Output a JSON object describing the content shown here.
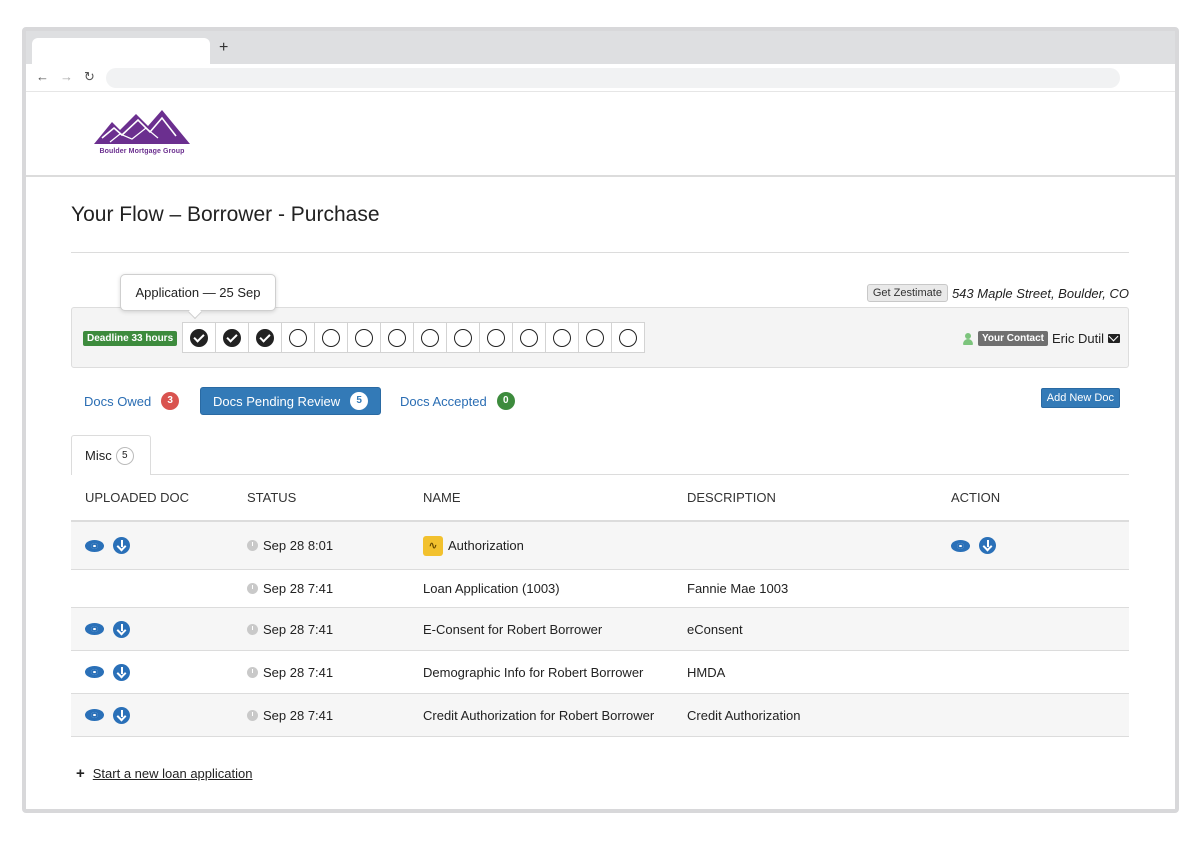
{
  "browser": {
    "new_tab_label": "+"
  },
  "header": {
    "logo_text": "Boulder Mortgage Group",
    "brand_color": "#6b2f8f"
  },
  "page": {
    "title": "Your Flow – Borrower - Purchase"
  },
  "tooltip": {
    "text": "Application — 25 Sep"
  },
  "property": {
    "zestimate_label": "Get Zestimate",
    "address": "543 Maple Street, Boulder, CO"
  },
  "progress": {
    "deadline": "Deadline 33 hours",
    "steps_done": 3,
    "steps_total": 14,
    "contact_label": "Your Contact",
    "contact_name": "Eric Dutil"
  },
  "doc_tabs": {
    "owed": {
      "label": "Docs Owed",
      "count": "3",
      "color": "#d9534f"
    },
    "pending": {
      "label": "Docs Pending Review",
      "count": "5",
      "color": "#337ab7"
    },
    "accepted": {
      "label": "Docs Accepted",
      "count": "0",
      "color": "#3d8b3d"
    },
    "add_label": "Add New Doc"
  },
  "misc_tab": {
    "label": "Misc",
    "count": "5"
  },
  "table": {
    "headers": {
      "uploaded": "UPLOADED DOC",
      "status": "STATUS",
      "name": "NAME",
      "description": "DESCRIPTION",
      "action": "ACTION"
    },
    "rows": [
      {
        "status": "Sep 28 8:01",
        "name": "Authorization",
        "description": ""
      },
      {
        "status": "Sep 28 7:41",
        "name": "Loan Application (1003)",
        "description": "Fannie Mae 1003"
      },
      {
        "status": "Sep 28 7:41",
        "name": "E-Consent for Robert Borrower",
        "description": "eConsent"
      },
      {
        "status": "Sep 28 7:41",
        "name": "Demographic Info for Robert Borrower",
        "description": "HMDA"
      },
      {
        "status": "Sep 28 7:41",
        "name": "Credit Authorization for Robert Borrower",
        "description": "Credit Authorization"
      }
    ]
  },
  "footer_link": {
    "plus": "+",
    "label": "Start a new loan application"
  }
}
